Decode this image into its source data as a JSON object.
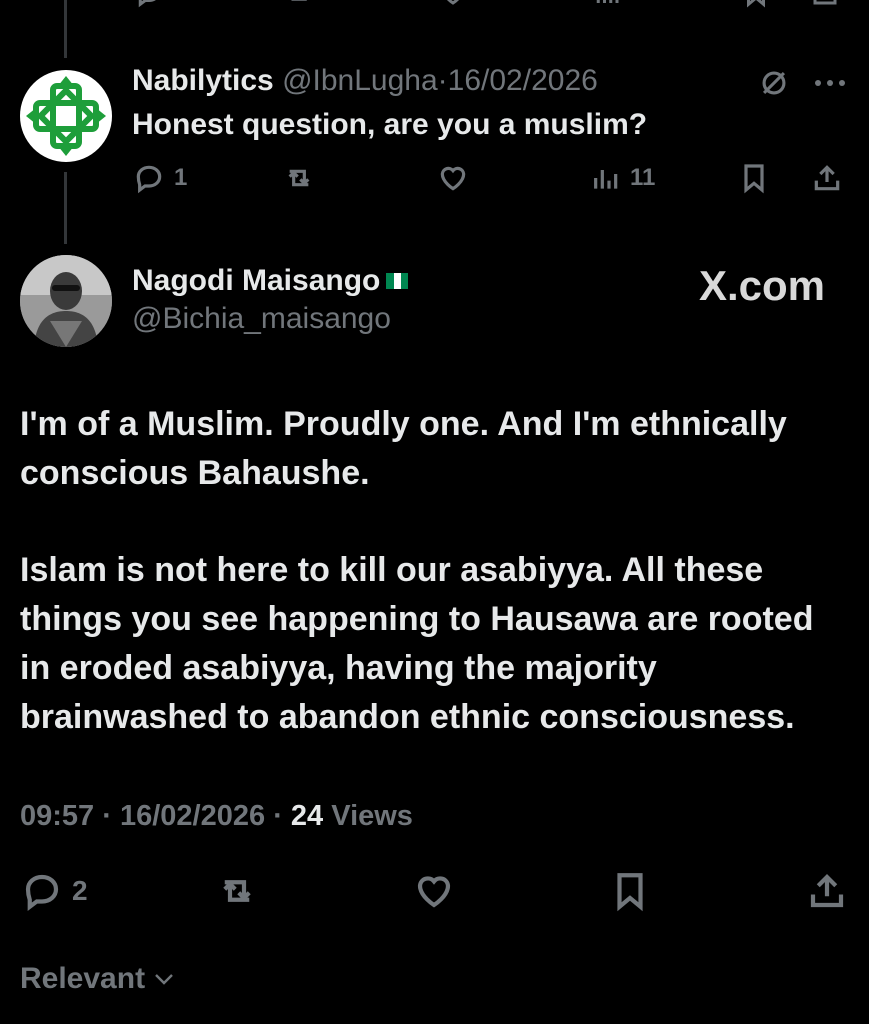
{
  "parent_tweet": {
    "author_name": "Nabilytics",
    "handle": "@IbnLugha",
    "separator": "·",
    "date": "16/02/2026",
    "text": "Honest question, are you a muslim?",
    "replies": "1",
    "views": "11"
  },
  "main_tweet": {
    "author_name": "Nagodi Maisango",
    "handle": "@Bichia_maisango",
    "watermark": "X.com",
    "paragraph_1": "I'm of a Muslim. Proudly one. And I'm ethnically conscious Bahaushe.",
    "paragraph_2": "Islam is not here to kill our asabiyya. All these things you see happening to Hausawa are rooted in eroded asabiyya, having the majority brainwashed to abandon ethnic consciousness.",
    "time": "09:57",
    "separator": "·",
    "date": "16/02/2026",
    "views_count": "24",
    "views_label": "Views",
    "replies": "2"
  },
  "sort": {
    "label": "Relevant"
  },
  "icons": {
    "reply": "reply-icon",
    "repost": "repost-icon",
    "like": "heart-icon",
    "views": "views-icon",
    "bookmark": "bookmark-icon",
    "share": "share-icon",
    "grok": "grok-icon",
    "more": "more-icon",
    "chevron": "chevron-down-icon"
  },
  "colors": {
    "background": "#000000",
    "text": "#e7e9ea",
    "secondary": "#71767b",
    "logo_green": "#1e9e3a",
    "flag_green": "#008751"
  }
}
